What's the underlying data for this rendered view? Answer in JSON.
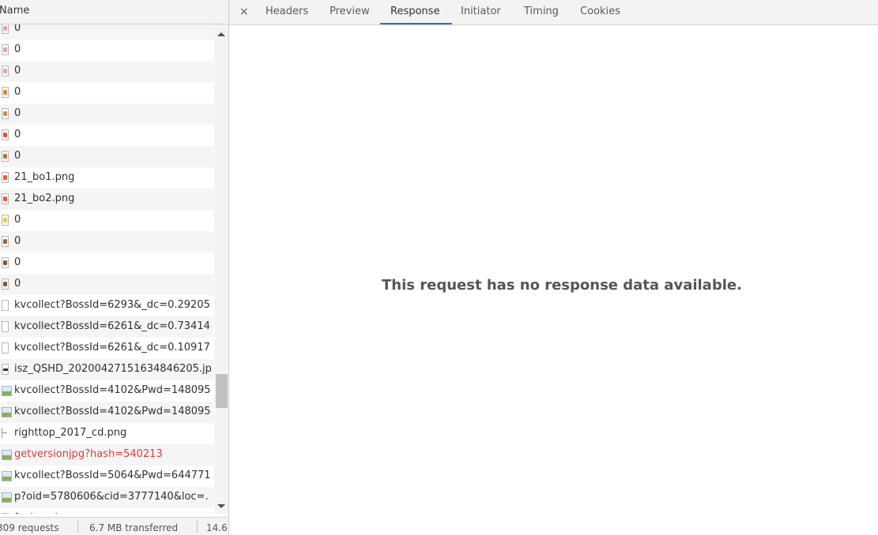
{
  "left": {
    "header_label": "Name",
    "rows": [
      {
        "icon": "pink-image-icon",
        "color": "#e89ac8",
        "text": "0",
        "kind": "dot"
      },
      {
        "icon": "pink-image-icon",
        "color": "#e89ac8",
        "text": "0",
        "kind": "dot"
      },
      {
        "icon": "pink-image-icon",
        "color": "#e89ac8",
        "text": "0",
        "kind": "dot"
      },
      {
        "icon": "orange-image-icon",
        "color": "#d98a2b",
        "text": "0",
        "kind": "dot"
      },
      {
        "icon": "orange-image-icon",
        "color": "#d98a2b",
        "text": "0",
        "kind": "dot"
      },
      {
        "icon": "red-image-icon",
        "color": "#e05030",
        "text": "0",
        "kind": "dot"
      },
      {
        "icon": "brown-image-icon",
        "color": "#b8742a",
        "text": "0",
        "kind": "dot"
      },
      {
        "icon": "red-image-icon",
        "color": "#e85a3a",
        "text": "21_bo1.png",
        "kind": "dot"
      },
      {
        "icon": "red-image-icon",
        "color": "#e85a3a",
        "text": "21_bo2.png",
        "kind": "dot"
      },
      {
        "icon": "yellow-image-icon",
        "color": "#f0c040",
        "text": "0",
        "kind": "dot"
      },
      {
        "icon": "brown-image-icon",
        "color": "#a0622a",
        "text": "0",
        "kind": "dot"
      },
      {
        "icon": "brown-image-icon",
        "color": "#8a5228",
        "text": "0",
        "kind": "dot"
      },
      {
        "icon": "brown-image-icon",
        "color": "#8a5228",
        "text": "0",
        "kind": "dot"
      },
      {
        "icon": "document-icon",
        "color": "#ffffff",
        "text": "kvcollect?BossId=6293&_dc=0.29205",
        "kind": "doc"
      },
      {
        "icon": "document-icon",
        "color": "#ffffff",
        "text": "kvcollect?BossId=6261&_dc=0.73414",
        "kind": "doc"
      },
      {
        "icon": "document-icon",
        "color": "#ffffff",
        "text": "kvcollect?BossId=6261&_dc=0.10917",
        "kind": "doc"
      },
      {
        "icon": "jpg-image-icon",
        "color": "#333333",
        "text": "isz_QSHD_20200427151634846205.jp",
        "kind": "jpg"
      },
      {
        "icon": "image-icon",
        "color": "#8cb14a",
        "text": "kvcollect?BossId=4102&Pwd=148095",
        "kind": "img"
      },
      {
        "icon": "image-icon",
        "color": "#8cb14a",
        "text": "kvcollect?BossId=4102&Pwd=148095",
        "kind": "img"
      },
      {
        "icon": "dash-icon",
        "color": "#888888",
        "text": "righttop_2017_cd.png",
        "kind": "dash"
      },
      {
        "icon": "image-icon",
        "color": "#8cb14a",
        "text": "getversionjpg?hash=540213",
        "kind": "img",
        "error": true
      },
      {
        "icon": "image-icon",
        "color": "#8cb14a",
        "text": "kvcollect?BossId=5064&Pwd=644771",
        "kind": "img"
      },
      {
        "icon": "image-icon",
        "color": "#8cb14a",
        "text": "p?oid=5780606&cid=3777140&loc=.",
        "kind": "img"
      },
      {
        "icon": "document-icon",
        "color": "#ffffff",
        "text": "favicon.ico",
        "kind": "doc"
      }
    ],
    "status": {
      "requests": "309 requests",
      "transferred": "6.7 MB transferred",
      "resources": "14.6"
    }
  },
  "right": {
    "close_label": "×",
    "tabs": [
      {
        "name": "tab-headers",
        "label": "Headers"
      },
      {
        "name": "tab-preview",
        "label": "Preview"
      },
      {
        "name": "tab-response",
        "label": "Response",
        "active": true
      },
      {
        "name": "tab-initiator",
        "label": "Initiator"
      },
      {
        "name": "tab-timing",
        "label": "Timing"
      },
      {
        "name": "tab-cookies",
        "label": "Cookies"
      }
    ],
    "empty_message": "This request has no response data available."
  }
}
